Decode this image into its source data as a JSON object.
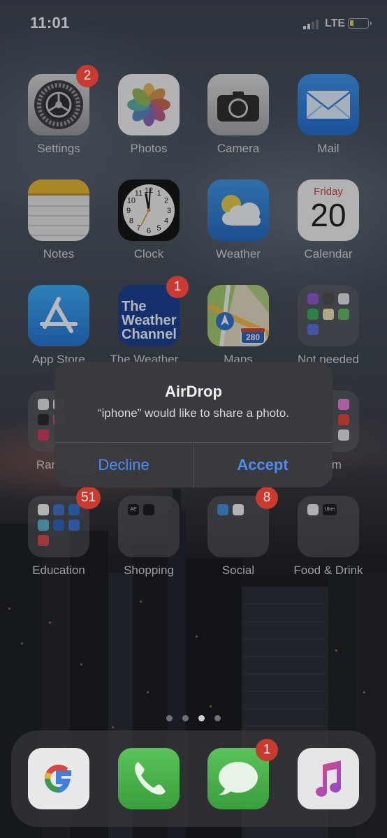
{
  "status": {
    "time": "11:01",
    "network": "LTE",
    "battery_icon": "battery-low-icon",
    "signal_icon": "signal-icon"
  },
  "apps": {
    "settings": {
      "label": "Settings",
      "badge": "2",
      "icon": "gear-icon"
    },
    "photos": {
      "label": "Photos",
      "icon": "photos-flower-icon"
    },
    "camera": {
      "label": "Camera",
      "icon": "camera-icon"
    },
    "mail": {
      "label": "Mail",
      "icon": "envelope-icon"
    },
    "notes": {
      "label": "Notes",
      "icon": "notepad-icon"
    },
    "clock": {
      "label": "Clock",
      "icon": "clock-icon",
      "numerals": [
        "12",
        "1",
        "2",
        "3",
        "4",
        "5",
        "6",
        "7",
        "8",
        "9",
        "10",
        "11"
      ]
    },
    "weather": {
      "label": "Weather",
      "icon": "sun-cloud-icon"
    },
    "calendar": {
      "label": "Calendar",
      "day_name": "Friday",
      "day_number": "20",
      "icon": "calendar-icon"
    },
    "appstore": {
      "label": "App Store",
      "icon": "app-store-icon"
    },
    "weather_channel": {
      "label": "The Weather...",
      "badge": "1",
      "logo_lines": [
        "The",
        "Weather",
        "Channel"
      ]
    },
    "maps": {
      "label": "Maps",
      "shield": "280",
      "icon": "map-icon"
    },
    "not_needed": {
      "label": "Not needed",
      "icon": "folder-icon"
    },
    "random": {
      "label": "Random",
      "icon": "folder-icon"
    },
    "right_folder": {
      "label": "...om",
      "icon": "folder-icon"
    },
    "education": {
      "label": "Education",
      "badge": "51",
      "icon": "folder-icon"
    },
    "shopping": {
      "label": "Shopping",
      "icon": "folder-icon",
      "mini": "AE"
    },
    "social": {
      "label": "Social",
      "badge": "8",
      "icon": "folder-icon"
    },
    "food": {
      "label": "Food & Drink",
      "icon": "folder-icon",
      "mini": "Uber"
    }
  },
  "dock": {
    "google": {
      "icon": "google-g-icon"
    },
    "phone": {
      "icon": "phone-handset-icon"
    },
    "messages": {
      "icon": "speech-bubble-icon",
      "badge": "1"
    },
    "music": {
      "icon": "music-note-icon"
    }
  },
  "alert": {
    "title": "AirDrop",
    "message": "“iphone” would like to share a photo.",
    "decline_label": "Decline",
    "accept_label": "Accept",
    "accent_color": "#4a8ef0"
  },
  "page_dots": {
    "count": 4,
    "active_index": 2
  },
  "colors": {
    "badge": "#c93b30",
    "alert_bg": "#3a3a3e"
  }
}
